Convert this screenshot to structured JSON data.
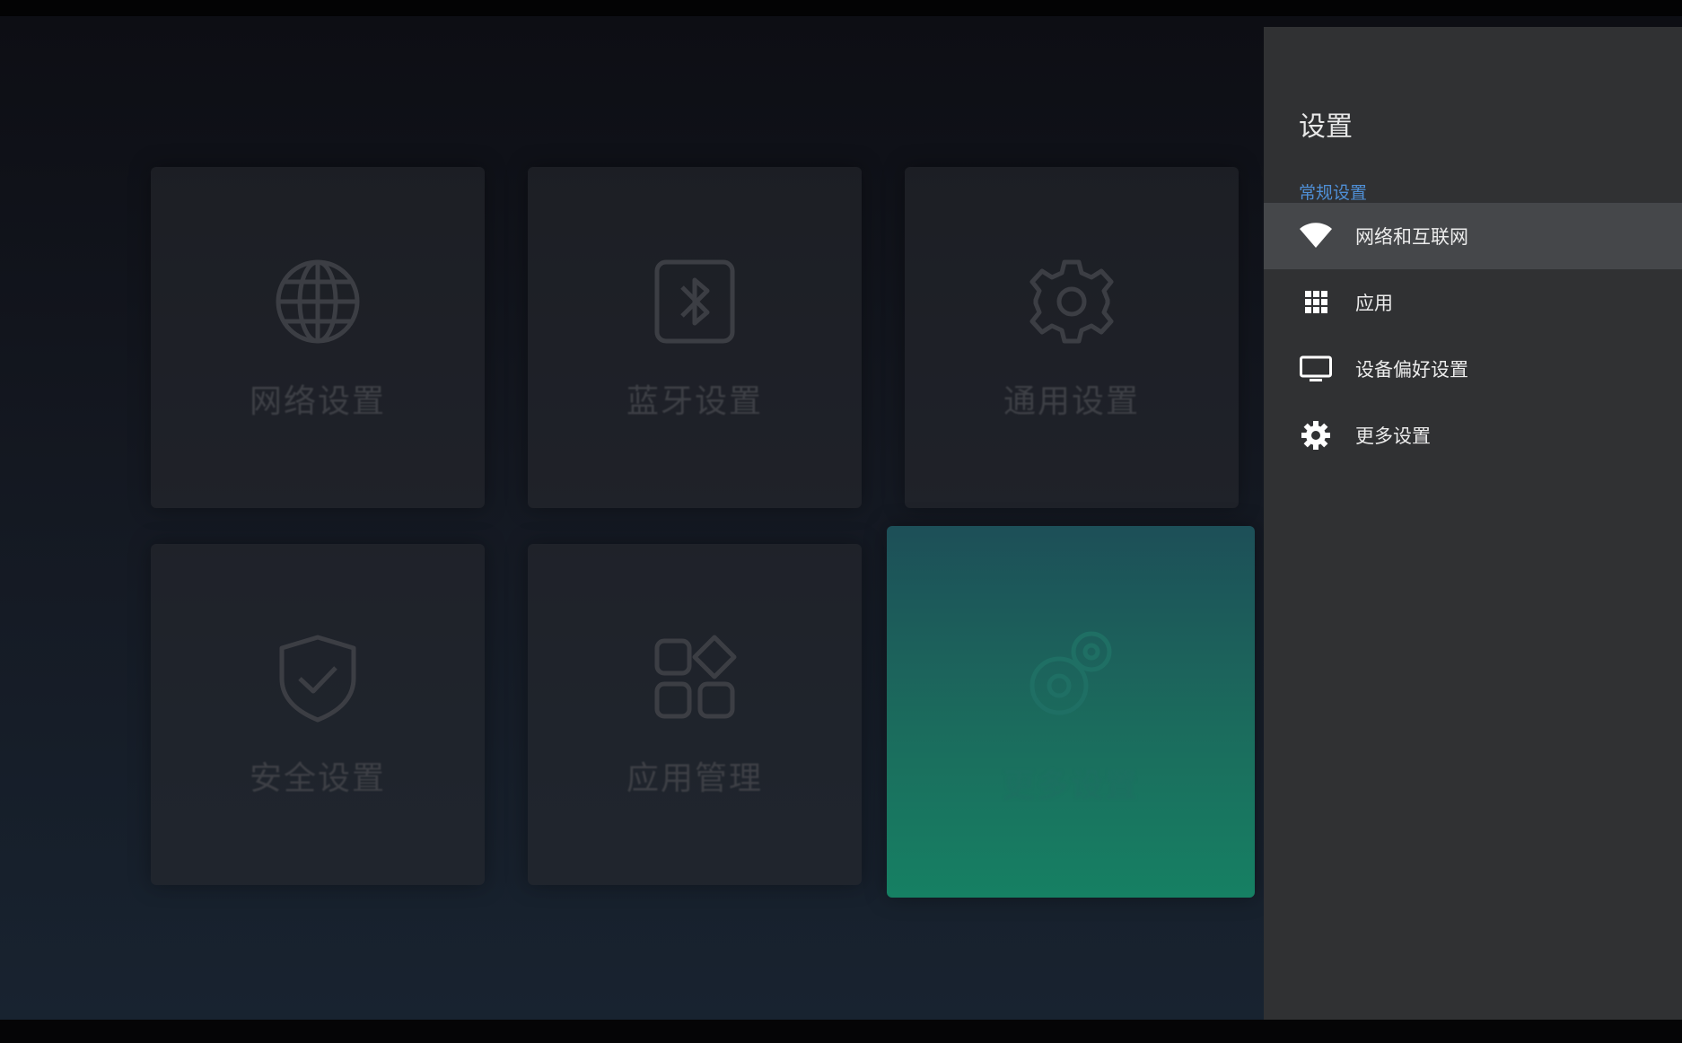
{
  "background_tiles": [
    {
      "label": "网络设置",
      "icon": "globe-icon"
    },
    {
      "label": "蓝牙设置",
      "icon": "bluetooth-icon"
    },
    {
      "label": "通用设置",
      "icon": "gear-icon"
    },
    {
      "label": "安全设置",
      "icon": "shield-check-icon"
    },
    {
      "label": "应用管理",
      "icon": "apps-grid-icon"
    },
    {
      "label": "更多设置",
      "icon": "gears-icon"
    }
  ],
  "panel": {
    "title": "设置",
    "section_title": "常规设置",
    "items": [
      {
        "label": "网络和互联网",
        "icon": "wifi-icon",
        "selected": true
      },
      {
        "label": "应用",
        "icon": "apps-grid-icon",
        "selected": false
      },
      {
        "label": "设备偏好设置",
        "icon": "tv-icon",
        "selected": false
      },
      {
        "label": "更多设置",
        "icon": "gear-icon",
        "selected": false
      }
    ]
  },
  "colors": {
    "panel_bg": "#303133",
    "selected_item_bg": "#45474a",
    "section_title": "#4f8fd6",
    "active_tile": "#168063"
  }
}
